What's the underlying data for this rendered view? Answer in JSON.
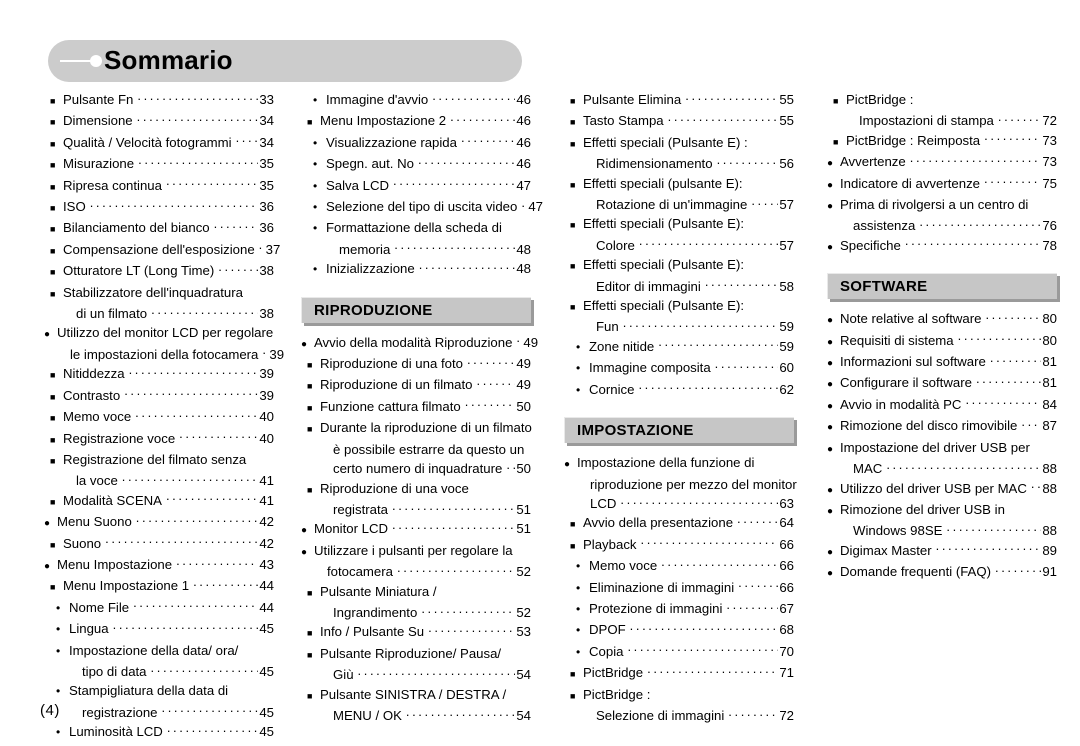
{
  "page": {
    "title": "Sommario",
    "page_number": "(4)"
  },
  "columns": [
    {
      "id": "column-1",
      "blocks": [
        {
          "type": "entries",
          "entries": [
            {
              "bullet": "square",
              "label": "Pulsante Fn",
              "page": "33"
            },
            {
              "bullet": "square",
              "label": "Dimensione",
              "page": "34"
            },
            {
              "bullet": "square",
              "label": "Qualità / Velocità fotogrammi",
              "page": "34"
            },
            {
              "bullet": "square",
              "label": "Misurazione",
              "page": "35"
            },
            {
              "bullet": "square",
              "label": "Ripresa continua",
              "page": "35"
            },
            {
              "bullet": "square",
              "label": "ISO",
              "page": "36"
            },
            {
              "bullet": "square",
              "label": "Bilanciamento del bianco",
              "page": "36"
            },
            {
              "bullet": "square",
              "label": "Compensazione dell'esposizione",
              "page": "37"
            },
            {
              "bullet": "square",
              "label": "Otturatore LT (Long Time)",
              "page": "38"
            },
            {
              "bullet": "square",
              "label": "Stabilizzatore dell'inquadratura",
              "page": ""
            },
            {
              "bullet": "cont-square",
              "label": "di un filmato",
              "page": "38"
            },
            {
              "bullet": "circle",
              "label": "Utilizzo del monitor LCD per regolare",
              "page": ""
            },
            {
              "bullet": "cont-circle",
              "label": "le impostazioni della fotocamera",
              "page": "39"
            },
            {
              "bullet": "square",
              "label": "Nitiddezza",
              "page": "39"
            },
            {
              "bullet": "square",
              "label": "Contrasto",
              "page": "39"
            },
            {
              "bullet": "square",
              "label": "Memo voce",
              "page": "40"
            },
            {
              "bullet": "square",
              "label": "Registrazione voce",
              "page": "40"
            },
            {
              "bullet": "square",
              "label": "Registrazione del filmato senza",
              "page": ""
            },
            {
              "bullet": "cont-square",
              "label": "la voce",
              "page": "41"
            },
            {
              "bullet": "square",
              "label": "Modalità SCENA",
              "page": "41"
            },
            {
              "bullet": "circle",
              "label": "Menu Suono",
              "page": "42"
            },
            {
              "bullet": "square",
              "label": "Suono",
              "page": "42"
            },
            {
              "bullet": "circle",
              "label": "Menu Impostazione",
              "page": "43"
            },
            {
              "bullet": "square",
              "label": "Menu  Impostazione 1",
              "page": "44"
            },
            {
              "bullet": "dot",
              "label": "Nome File",
              "page": "44"
            },
            {
              "bullet": "dot",
              "label": "Lingua",
              "page": "45"
            },
            {
              "bullet": "dot",
              "label": "Impostazione della data/ ora/",
              "page": ""
            },
            {
              "bullet": "cont-dot",
              "label": "tipo di data",
              "page": "45"
            },
            {
              "bullet": "dot",
              "label": "Stampigliatura della data di",
              "page": ""
            },
            {
              "bullet": "cont-dot",
              "label": "registrazione",
              "page": "45"
            },
            {
              "bullet": "dot",
              "label": "Luminosità LCD",
              "page": "45"
            }
          ]
        }
      ]
    },
    {
      "id": "column-2",
      "blocks": [
        {
          "type": "entries",
          "entries": [
            {
              "bullet": "dot",
              "label": "Immagine d'avvio",
              "page": "46"
            },
            {
              "bullet": "square",
              "label": "Menu  Impostazione 2",
              "page": "46"
            },
            {
              "bullet": "dot",
              "label": "Visualizzazione rapida",
              "page": "46"
            },
            {
              "bullet": "dot",
              "label": "Spegn. aut. No",
              "page": "46"
            },
            {
              "bullet": "dot",
              "label": "Salva LCD",
              "page": "47"
            },
            {
              "bullet": "dot",
              "label": "Selezione del tipo di uscita video",
              "page": "47"
            },
            {
              "bullet": "dot",
              "label": "Formattazione della scheda di",
              "page": ""
            },
            {
              "bullet": "cont-dot",
              "label": "memoria",
              "page": "48"
            },
            {
              "bullet": "dot",
              "label": "Inizializzazione",
              "page": "48"
            }
          ]
        },
        {
          "type": "section",
          "heading": "RIPRODUZIONE",
          "entries": [
            {
              "bullet": "circle",
              "label": "Avvio della modalità Riproduzione",
              "page": "49"
            },
            {
              "bullet": "square",
              "label": "Riproduzione di una foto",
              "page": "49"
            },
            {
              "bullet": "square",
              "label": "Riproduzione di un filmato",
              "page": "49"
            },
            {
              "bullet": "square",
              "label": "Funzione cattura filmato",
              "page": "50"
            },
            {
              "bullet": "square",
              "label": "Durante la riproduzione di un filmato",
              "page": ""
            },
            {
              "bullet": "cont-square",
              "label": "è possibile estrarre da questo un",
              "page": ""
            },
            {
              "bullet": "cont-square",
              "label": "certo numero di inquadrature",
              "page": "50"
            },
            {
              "bullet": "square",
              "label": "Riproduzione di una voce",
              "page": ""
            },
            {
              "bullet": "cont-square",
              "label": "registrata",
              "page": "51"
            },
            {
              "bullet": "circle",
              "label": "Monitor LCD",
              "page": "51"
            },
            {
              "bullet": "circle",
              "label": "Utilizzare i pulsanti per regolare la",
              "page": ""
            },
            {
              "bullet": "cont-circle",
              "label": "fotocamera",
              "page": "52"
            },
            {
              "bullet": "square",
              "label": "Pulsante Miniatura /",
              "page": ""
            },
            {
              "bullet": "cont-square",
              "label": "Ingrandimento",
              "page": "52"
            },
            {
              "bullet": "square",
              "label": "Info / Pulsante Su",
              "page": "53"
            },
            {
              "bullet": "square",
              "label": "Pulsante Riproduzione/ Pausa/",
              "page": ""
            },
            {
              "bullet": "cont-square",
              "label": "Giù",
              "page": "54"
            },
            {
              "bullet": "square",
              "label": "Pulsante SINISTRA / DESTRA /",
              "page": ""
            },
            {
              "bullet": "cont-square",
              "label": "MENU / OK",
              "page": "54"
            }
          ]
        }
      ]
    },
    {
      "id": "column-3",
      "blocks": [
        {
          "type": "entries",
          "entries": [
            {
              "bullet": "square",
              "label": "Pulsante Elimina",
              "page": "55"
            },
            {
              "bullet": "square",
              "label": "Tasto Stampa",
              "page": "55"
            },
            {
              "bullet": "square",
              "label": "Effetti speciali (Pulsante E) :",
              "page": ""
            },
            {
              "bullet": "cont-square",
              "label": "Ridimensionamento",
              "page": "56"
            },
            {
              "bullet": "square",
              "label": "Effetti speciali (pulsante E):",
              "page": ""
            },
            {
              "bullet": "cont-square",
              "label": "Rotazione di un'immagine",
              "page": "57"
            },
            {
              "bullet": "square",
              "label": "Effetti speciali (Pulsante E):",
              "page": ""
            },
            {
              "bullet": "cont-square",
              "label": "Colore",
              "page": "57"
            },
            {
              "bullet": "square",
              "label": "Effetti speciali (Pulsante E):",
              "page": ""
            },
            {
              "bullet": "cont-square",
              "label": "Editor di immagini",
              "page": "58"
            },
            {
              "bullet": "square",
              "label": "Effetti speciali (Pulsante E):",
              "page": ""
            },
            {
              "bullet": "cont-square",
              "label": "Fun",
              "page": "59"
            },
            {
              "bullet": "dot",
              "label": "Zone nitide",
              "page": "59"
            },
            {
              "bullet": "dot",
              "label": "Immagine composita",
              "page": "60"
            },
            {
              "bullet": "dot",
              "label": "Cornice",
              "page": "62"
            }
          ]
        },
        {
          "type": "section",
          "heading": "IMPOSTAZIONE",
          "entries": [
            {
              "bullet": "circle",
              "label": "Impostazione della funzione di",
              "page": ""
            },
            {
              "bullet": "cont-circle",
              "label": "riproduzione per mezzo del monitor",
              "page": ""
            },
            {
              "bullet": "cont-circle",
              "label": "LCD",
              "page": "63"
            },
            {
              "bullet": "square",
              "label": "Avvio della presentazione",
              "page": "64"
            },
            {
              "bullet": "square",
              "label": "Playback",
              "page": "66"
            },
            {
              "bullet": "dot",
              "label": "Memo voce",
              "page": "66"
            },
            {
              "bullet": "dot",
              "label": "Eliminazione di immagini",
              "page": "66"
            },
            {
              "bullet": "dot",
              "label": "Protezione di immagini",
              "page": "67"
            },
            {
              "bullet": "dot",
              "label": "DPOF",
              "page": "68"
            },
            {
              "bullet": "dot",
              "label": "Copia",
              "page": "70"
            },
            {
              "bullet": "square",
              "label": "PictBridge",
              "page": "71"
            },
            {
              "bullet": "square",
              "label": "PictBridge :",
              "page": ""
            },
            {
              "bullet": "cont-square",
              "label": "Selezione di immagini",
              "page": "72"
            }
          ]
        }
      ]
    },
    {
      "id": "column-4",
      "blocks": [
        {
          "type": "entries",
          "entries": [
            {
              "bullet": "square",
              "label": "PictBridge :",
              "page": ""
            },
            {
              "bullet": "cont-square",
              "label": "Impostazioni di stampa",
              "page": "72"
            },
            {
              "bullet": "square",
              "label": "PictBridge : Reimposta",
              "page": "73"
            },
            {
              "bullet": "circle",
              "label": "Avvertenze",
              "page": "73"
            },
            {
              "bullet": "circle",
              "label": "Indicatore di avvertenze",
              "page": "75"
            },
            {
              "bullet": "circle",
              "label": "Prima di rivolgersi a un centro di",
              "page": ""
            },
            {
              "bullet": "cont-circle",
              "label": "assistenza",
              "page": "76"
            },
            {
              "bullet": "circle",
              "label": "Specifiche",
              "page": "78"
            }
          ]
        },
        {
          "type": "section",
          "heading": "SOFTWARE",
          "entries": [
            {
              "bullet": "circle",
              "label": "Note relative al software",
              "page": "80"
            },
            {
              "bullet": "circle",
              "label": "Requisiti di sistema",
              "page": "80"
            },
            {
              "bullet": "circle",
              "label": "Informazioni sul software",
              "page": "81"
            },
            {
              "bullet": "circle",
              "label": "Configurare il software",
              "page": "81"
            },
            {
              "bullet": "circle",
              "label": "Avvio in modalità PC",
              "page": "84"
            },
            {
              "bullet": "circle",
              "label": "Rimozione del disco rimovibile",
              "page": "87"
            },
            {
              "bullet": "circle",
              "label": "Impostazione del driver USB per",
              "page": ""
            },
            {
              "bullet": "cont-circle",
              "label": "MAC",
              "page": "88"
            },
            {
              "bullet": "circle",
              "label": "Utilizzo del driver USB per MAC",
              "page": "88"
            },
            {
              "bullet": "circle",
              "label": "Rimozione del driver USB in",
              "page": ""
            },
            {
              "bullet": "cont-circle",
              "label": "Windows 98SE",
              "page": "88"
            },
            {
              "bullet": "circle",
              "label": "Digimax Master",
              "page": "89"
            },
            {
              "bullet": "circle",
              "label": "Domande frequenti (FAQ)",
              "page": "91"
            }
          ]
        }
      ]
    }
  ],
  "colors": {
    "title_bar_bg": "#cccccc",
    "section_header_bg": "#c6c6c6",
    "section_header_shadow": "#9a9a9a",
    "text": "#000000",
    "page_bg": "#ffffff"
  }
}
